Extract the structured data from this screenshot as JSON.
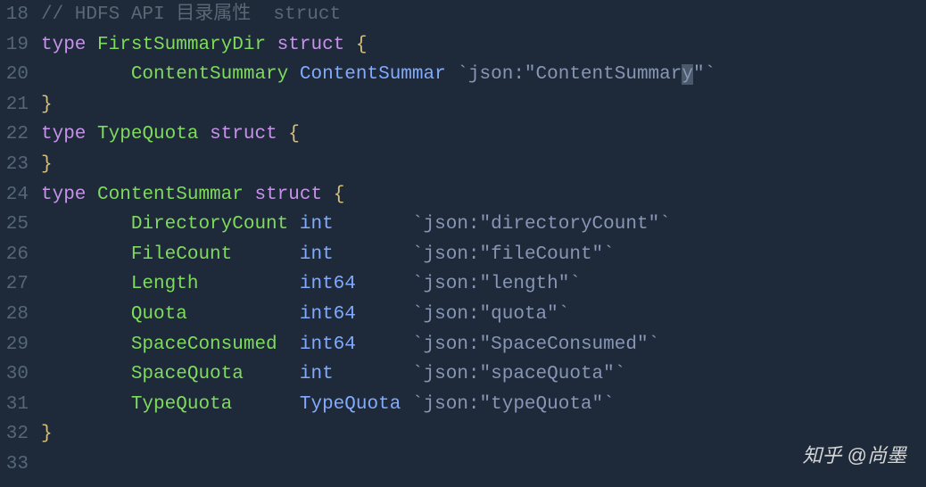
{
  "lineNumbers": [
    "18",
    "19",
    "20",
    "21",
    "22",
    "23",
    "24",
    "25",
    "26",
    "27",
    "28",
    "29",
    "30",
    "31",
    "32",
    "33"
  ],
  "lines": {
    "comment": "// HDFS API 目录属性  struct",
    "l19": {
      "kw1": "type",
      "name": "FirstSummaryDir",
      "kw2": "struct",
      "brace": "{"
    },
    "l20": {
      "indent": "        ",
      "field": "ContentSummary",
      "type": "ContentSummar",
      "tag_pre": "`json:\"ContentSummar",
      "tag_hl": "y",
      "tag_post": "\"`"
    },
    "l21": {
      "brace": "}"
    },
    "l22": {
      "kw1": "type",
      "name": "TypeQuota",
      "kw2": "struct",
      "brace": "{"
    },
    "l23": {
      "brace": "}"
    },
    "l24": {
      "kw1": "type",
      "name": "ContentSummar",
      "kw2": "struct",
      "brace": "{"
    },
    "l25": {
      "indent": "        ",
      "field": "DirectoryCount",
      "type": "int   ",
      "tag": "`json:\"directoryCount\"`"
    },
    "l26": {
      "indent": "        ",
      "field": "FileCount     ",
      "type": "int   ",
      "tag": "`json:\"fileCount\"`"
    },
    "l27": {
      "indent": "        ",
      "field": "Length        ",
      "type": "int64 ",
      "tag": "`json:\"length\"`"
    },
    "l28": {
      "indent": "        ",
      "field": "Quota         ",
      "type": "int64 ",
      "tag": "`json:\"quota\"`"
    },
    "l29": {
      "indent": "        ",
      "field": "SpaceConsumed ",
      "type": "int64 ",
      "tag": "`json:\"SpaceConsumed\"`"
    },
    "l30": {
      "indent": "        ",
      "field": "SpaceQuota    ",
      "type": "int   ",
      "tag": "`json:\"spaceQuota\"`"
    },
    "l31": {
      "indent": "        ",
      "field": "TypeQuota     ",
      "type": "TypeQuota",
      "tag": "`json:\"typeQuota\"`"
    },
    "l32": {
      "brace": "}"
    }
  },
  "watermark": {
    "brand": "知乎",
    "at": "@",
    "user": "尚墨"
  }
}
